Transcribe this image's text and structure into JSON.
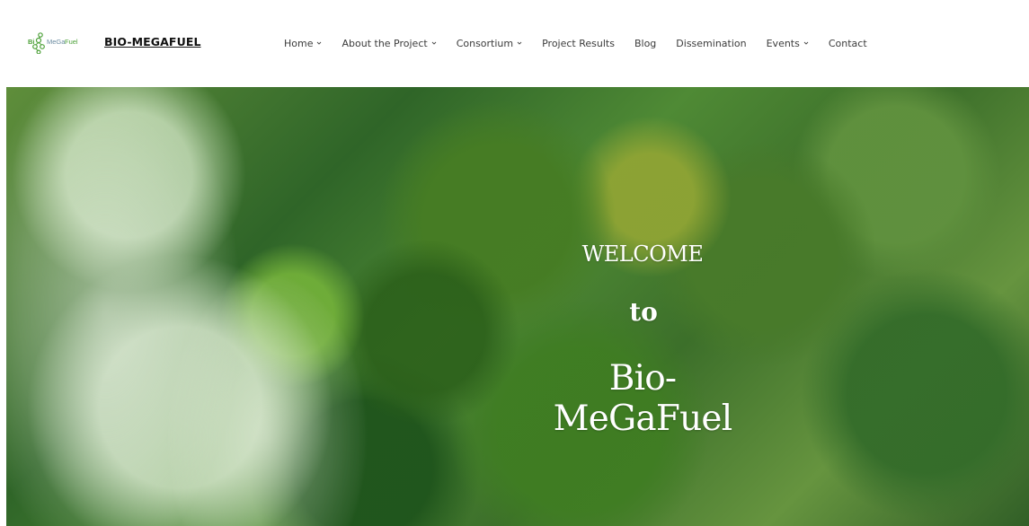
{
  "header": {
    "logo_text": "BiOMeGaFuel",
    "site_title": "BIO-MEGAFUEL",
    "nav": [
      {
        "label": "Home",
        "has_dropdown": true
      },
      {
        "label": "About the Project",
        "has_dropdown": true
      },
      {
        "label": "Consortium",
        "has_dropdown": true
      },
      {
        "label": "Project Results",
        "has_dropdown": false
      },
      {
        "label": "Blog",
        "has_dropdown": false
      },
      {
        "label": "Dissemination",
        "has_dropdown": false
      },
      {
        "label": "Events",
        "has_dropdown": true
      },
      {
        "label": "Contact",
        "has_dropdown": false
      }
    ]
  },
  "hero": {
    "line1": "WELCOME",
    "line2": "to",
    "line3": "Bio-MeGaFuel"
  },
  "colors": {
    "logo_green": "#4ea13a",
    "logo_blue": "#6b8ca1",
    "text_dark": "#111111",
    "nav_text": "#3b3b3b",
    "hero_text": "#ffffff"
  },
  "icons": {
    "logo": "molecule-logo-icon",
    "dropdown": "chevron-down-icon"
  }
}
